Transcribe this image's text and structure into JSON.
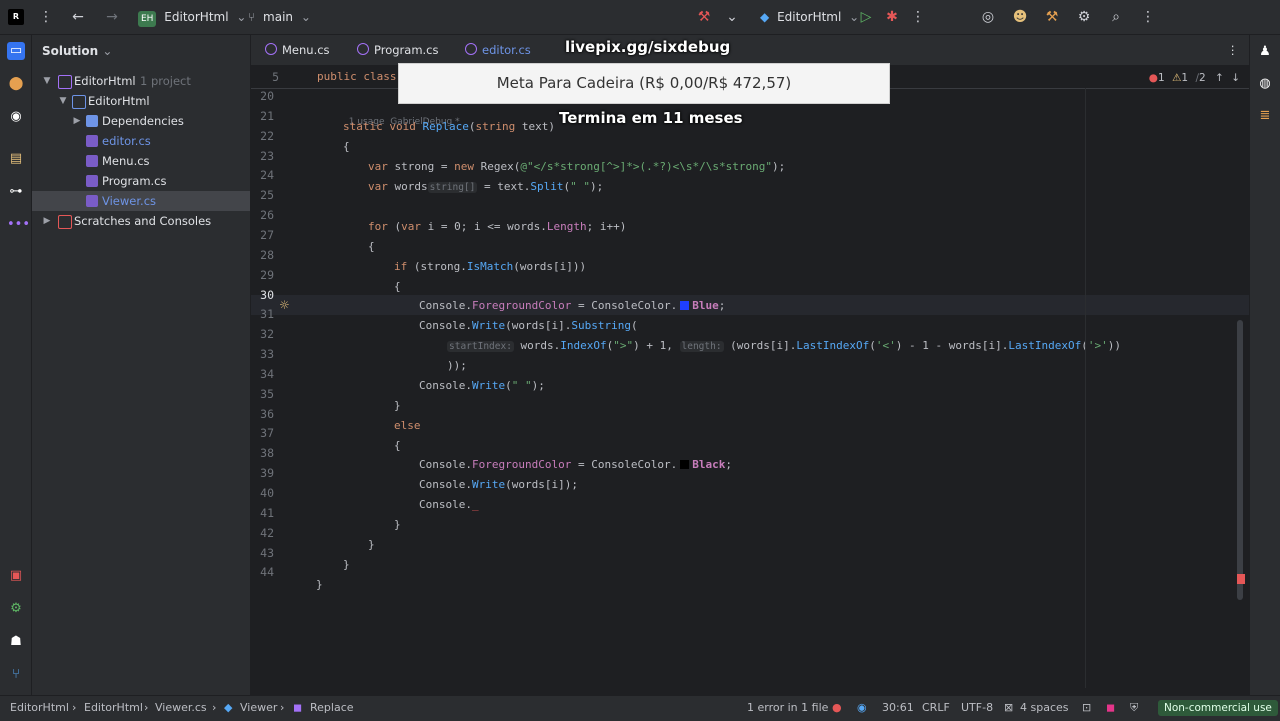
{
  "topbar": {
    "project_initials": "EH",
    "project_name": "EditorHtml",
    "branch": "main",
    "run_config": "EditorHtml"
  },
  "sidebar": {
    "title": "Solution",
    "items": [
      {
        "label": "EditorHtml",
        "note": "1 project"
      },
      {
        "label": "EditorHtml"
      },
      {
        "label": "Dependencies"
      },
      {
        "label": "editor.cs"
      },
      {
        "label": "Menu.cs"
      },
      {
        "label": "Program.cs"
      },
      {
        "label": "Viewer.cs"
      },
      {
        "label": "Scratches and Consoles"
      }
    ]
  },
  "tabs": [
    {
      "label": "Menu.cs"
    },
    {
      "label": "Program.cs"
    },
    {
      "label": "editor.cs"
    }
  ],
  "overlay": {
    "url": "livepix.gg/sixdebug",
    "goal": "Meta Para Cadeira (R$ 0,00/R$ 472,57)",
    "subtitle": "Termina em 11 meses"
  },
  "editor": {
    "sticky_line_number": "5",
    "sticky_text": "public class",
    "usage_hint": "1 usage",
    "author_hint": "GabrielDebug *",
    "error_counts": {
      "errors": "1",
      "warnings": "1",
      "weak": "2"
    },
    "line_numbers": [
      "20",
      "21",
      "22",
      "23",
      "24",
      "25",
      "26",
      "27",
      "28",
      "29",
      "30",
      "31",
      "32",
      "33",
      "34",
      "35",
      "36",
      "37",
      "38",
      "39",
      "40",
      "41",
      "42",
      "43",
      "44"
    ],
    "hints": {
      "string_arr": "string[]",
      "startindex": "startIndex:",
      "length": "length:"
    }
  },
  "statusbar": {
    "breadcrumb": [
      "EditorHtml",
      "EditorHtml",
      "Viewer.cs",
      "Viewer",
      "Replace"
    ],
    "errors": "1 error in 1 file",
    "position": "30:61",
    "line_ending": "CRLF",
    "encoding": "UTF-8",
    "indent": "4 spaces",
    "license": "Non-commercial use"
  },
  "colors": {
    "accent_green": "#4a8f5a",
    "error_red": "#e55757",
    "enum_blue": "#1f3fff"
  }
}
